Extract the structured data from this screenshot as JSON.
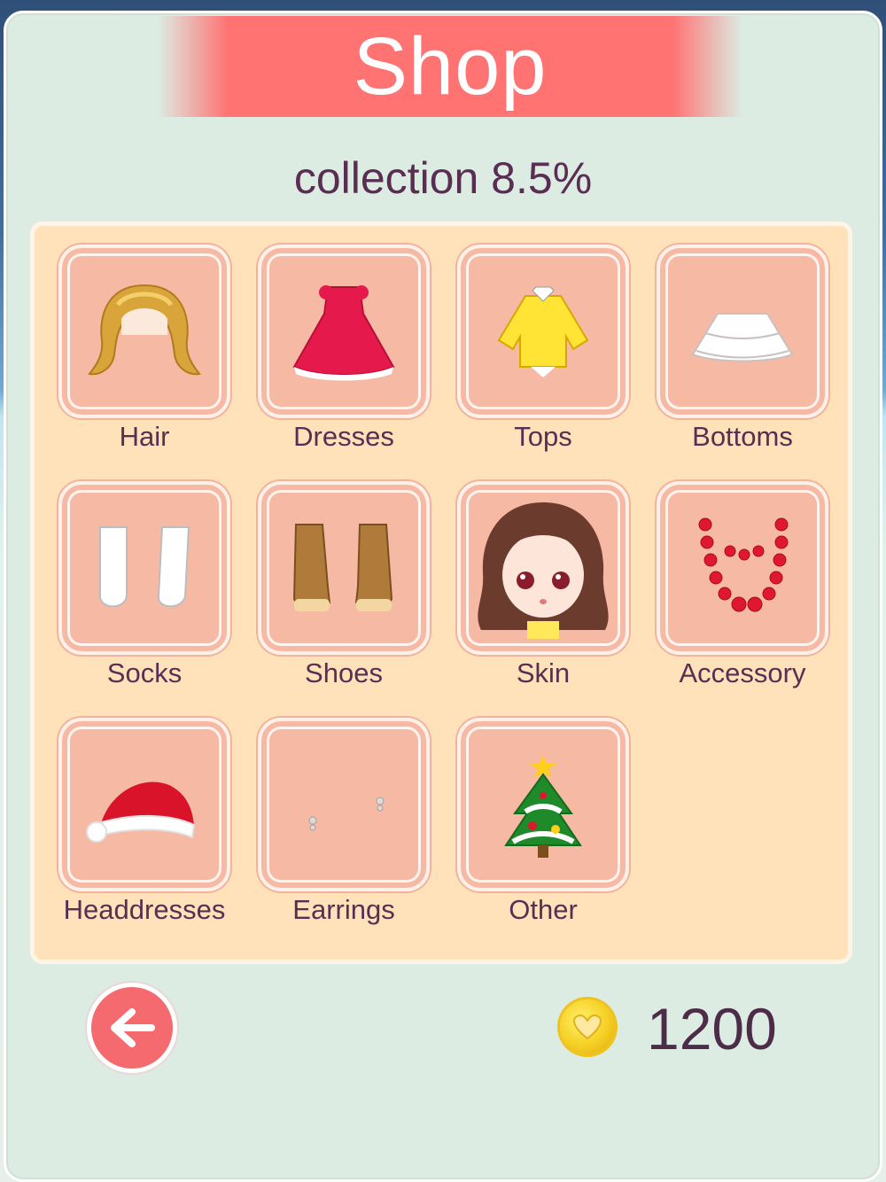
{
  "header": {
    "title": "Shop"
  },
  "collection_text": "collection 8.5%",
  "categories": [
    {
      "label": "Hair",
      "icon": "hair-icon"
    },
    {
      "label": "Dresses",
      "icon": "dress-icon"
    },
    {
      "label": "Tops",
      "icon": "top-icon"
    },
    {
      "label": "Bottoms",
      "icon": "skirt-icon"
    },
    {
      "label": "Socks",
      "icon": "socks-icon"
    },
    {
      "label": "Shoes",
      "icon": "shoes-icon"
    },
    {
      "label": "Skin",
      "icon": "doll-face-icon"
    },
    {
      "label": "Accessory",
      "icon": "necklace-icon"
    },
    {
      "label": "Headdresses",
      "icon": "santa-hat-icon"
    },
    {
      "label": "Earrings",
      "icon": "earrings-icon"
    },
    {
      "label": "Other",
      "icon": "christmas-tree-icon"
    }
  ],
  "footer": {
    "coins": "1200",
    "back_icon": "arrow-left-icon",
    "coin_icon": "heart-coin-icon"
  },
  "colors": {
    "banner": "#ff7373",
    "tile": "#f6b9a4",
    "panel": "#ffe2b9",
    "text": "#5a2e52"
  }
}
